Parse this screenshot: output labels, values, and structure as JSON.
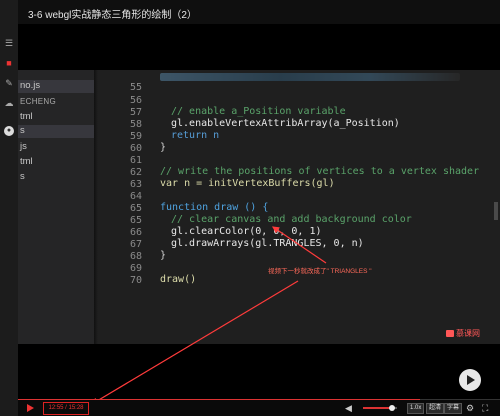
{
  "window": {
    "title": "3-6 webgl实战静态三角形的绘制（2）"
  },
  "rail": {
    "icons": [
      "menu-icon",
      "bookmark-icon",
      "edit-icon",
      "cloud-icon",
      "avatar-icon"
    ]
  },
  "explorer": {
    "items": [
      {
        "label": "no.js",
        "selected": true
      },
      {
        "label": "ECHENG",
        "section": true
      },
      {
        "label": "tml"
      },
      {
        "label": "s",
        "selected": true
      },
      {
        "label": "js"
      },
      {
        "label": "tml"
      },
      {
        "label": "s"
      }
    ]
  },
  "code": {
    "lines": [
      {
        "n": "55",
        "text": ""
      },
      {
        "n": "56",
        "text": "// enable a_Position variable"
      },
      {
        "n": "57",
        "text": "gl.enableVertexAttribArray(a_Position)"
      },
      {
        "n": "58",
        "text": "return n"
      },
      {
        "n": "59",
        "text": "}"
      },
      {
        "n": "60",
        "text": ""
      },
      {
        "n": "61",
        "text": "// write the positions of vertices to a vertex shader"
      },
      {
        "n": "62",
        "text": "var n = initVertexBuffers(gl)"
      },
      {
        "n": "63",
        "text": ""
      },
      {
        "n": "64",
        "text": "function draw () {"
      },
      {
        "n": "65",
        "text": "// clear canvas and add background color"
      },
      {
        "n": "65",
        "text": "gl.clearColor(0, 0, 0, 1)"
      },
      {
        "n": "66",
        "text": "gl.drawArrays(gl.TRANGLES, 0, n)"
      },
      {
        "n": "67",
        "text": "}"
      },
      {
        "n": "68",
        "text": ""
      },
      {
        "n": "69",
        "text": "draw()"
      },
      {
        "n": "70",
        "text": ""
      }
    ]
  },
  "annotation": {
    "text": "视频下一秒就改成了\" TRIANGLES \""
  },
  "watermark": {
    "text": "慕课网"
  },
  "player": {
    "time": "12:55 / 15:28",
    "progress": 0.835,
    "volume": 0.85,
    "speed_label": "1.0x",
    "quality_label": "超清",
    "subtitle_label": "字幕"
  },
  "colors": {
    "accent": "#dd3333",
    "comment": "#5aa36a",
    "keyword": "#569cd6",
    "function": "#dcdcaa"
  }
}
